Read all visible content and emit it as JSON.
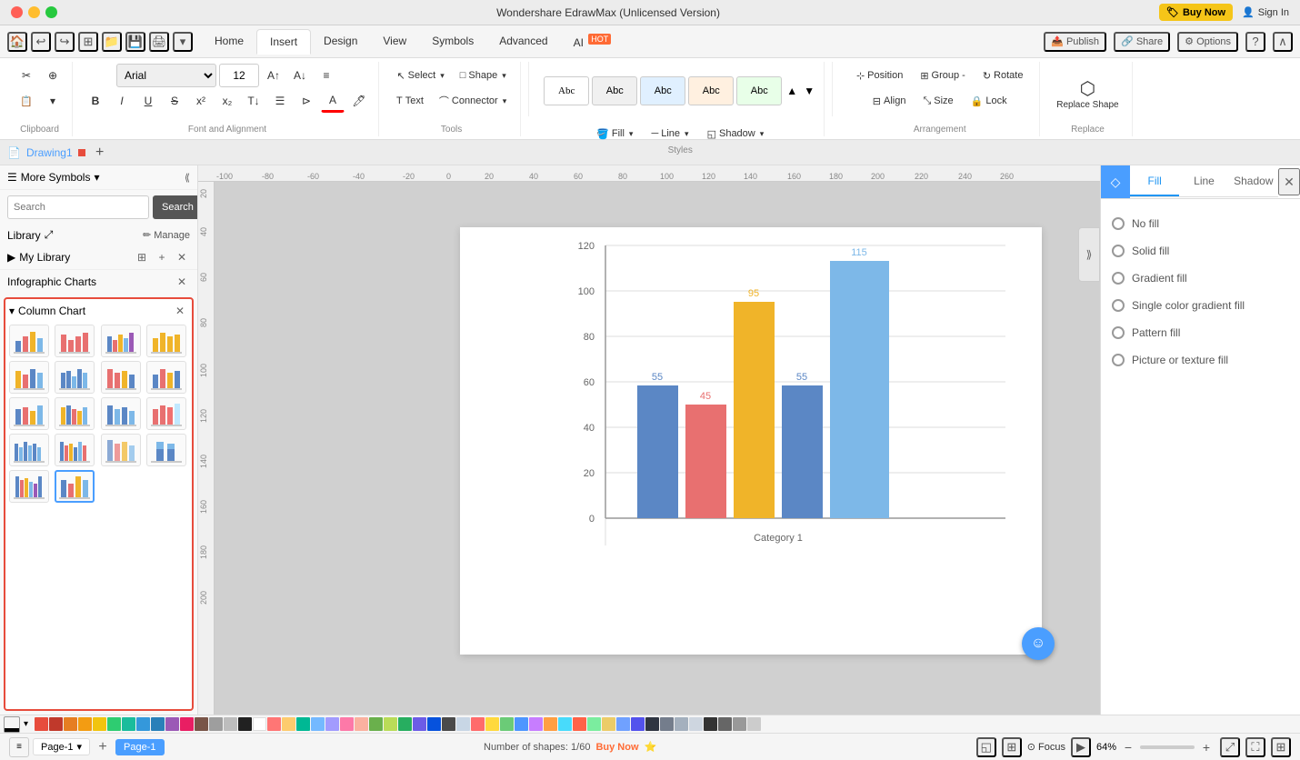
{
  "titlebar": {
    "title": "Wondershare EdrawMax (Unlicensed Version)",
    "buy_label": "Buy Now",
    "signin_label": "Sign In"
  },
  "menubar": {
    "tabs": [
      "Home",
      "Insert",
      "Design",
      "View",
      "Symbols",
      "Advanced",
      "AI"
    ],
    "active_tab": "Home",
    "ai_badge": "HOT"
  },
  "toolbar": {
    "font_family": "Arial",
    "font_size": "12",
    "select_label": "Select",
    "shape_label": "Shape",
    "text_label": "Text",
    "connector_label": "Connector",
    "fill_label": "Fill",
    "line_label": "Line",
    "shadow_label": "Shadow",
    "position_label": "Position",
    "group_label": "Group -",
    "rotate_label": "Rotate",
    "align_label": "Align",
    "size_label": "Size",
    "lock_label": "Lock",
    "replace_shape_label": "Replace Shape"
  },
  "left_panel": {
    "title": "More Symbols",
    "search_placeholder": "Search",
    "search_btn": "Search",
    "library_label": "Library",
    "manage_label": "Manage",
    "my_library_label": "My Library",
    "infographic_label": "Infographic Charts",
    "column_chart_label": "Column Chart"
  },
  "styles": {
    "items": [
      "Abc",
      "Abc",
      "Abc",
      "Abc",
      "Abc"
    ]
  },
  "right_panel": {
    "tabs": [
      "Fill",
      "Line",
      "Shadow"
    ],
    "active_tab": "Fill",
    "fill_options": [
      "No fill",
      "Solid fill",
      "Gradient fill",
      "Single color gradient fill",
      "Pattern fill",
      "Picture or texture fill"
    ]
  },
  "canvas": {
    "chart": {
      "category": "Category 1",
      "bars": [
        {
          "label": "55",
          "value": 55,
          "color": "#5b87c5"
        },
        {
          "label": "45",
          "value": 45,
          "color": "#e87070"
        },
        {
          "label": "95",
          "value": 95,
          "color": "#f0b429"
        },
        {
          "label": "55",
          "value": 55,
          "color": "#5b87c5"
        },
        {
          "label": "115",
          "value": 115,
          "color": "#7db8e8"
        }
      ],
      "y_labels": [
        "120",
        "100",
        "80",
        "60",
        "40",
        "20",
        "0"
      ]
    }
  },
  "statusbar": {
    "page_label": "Page-1",
    "active_page": "Page-1",
    "shapes_label": "Number of shapes: 1/60",
    "buy_now": "Buy Now",
    "focus_label": "Focus",
    "zoom_level": "64%"
  }
}
